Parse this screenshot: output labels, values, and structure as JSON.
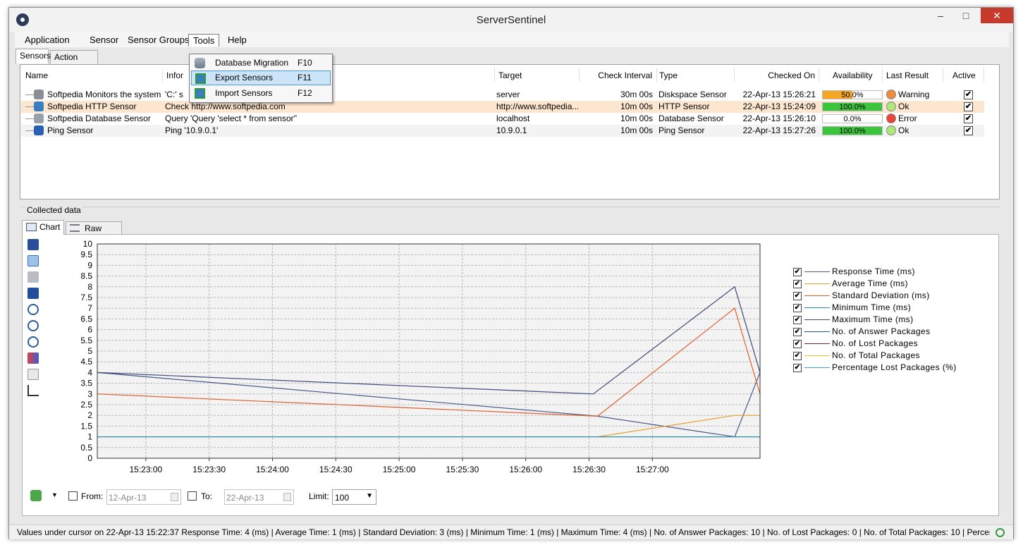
{
  "window": {
    "title": "ServerSentinel",
    "min": "–",
    "max": "□",
    "close": "✕"
  },
  "menu": [
    "Application",
    "Sensor",
    "Sensor Groups",
    "Tools",
    "Help"
  ],
  "tabs_top": [
    "Sensors",
    "Action Log"
  ],
  "columns": [
    "Name",
    "Infor",
    "Target",
    "Check Interval",
    "Type",
    "Checked On",
    "Availability",
    "Last Result",
    "Active"
  ],
  "rows": [
    {
      "name": "Softpedia Monitors the system p...",
      "info": "'C:' s",
      "target": "server",
      "interval": "30m 00s",
      "type": "Diskspace Sensor",
      "checked": "22-Apr-13 15:26:21",
      "availability": "50.0%",
      "avail_value": 0.5,
      "avail_color": "#f5a623",
      "result": "Warning",
      "lamp": "#f08a3c",
      "active": "✔"
    },
    {
      "name": "Softpedia HTTP Sensor",
      "info": "Check http://www.softpedia.com",
      "target": "http://www.softpedia....",
      "interval": "10m 00s",
      "type": "HTTP Sensor",
      "checked": "22-Apr-13 15:24:09",
      "availability": "100.0%",
      "avail_value": 1.0,
      "avail_color": "#3cc43c",
      "result": "Ok",
      "lamp": "#aee67a",
      "active": "✔"
    },
    {
      "name": "Softpedia Database Sensor",
      "info": "Query 'Query 'select * from sensor''",
      "target": "localhost",
      "interval": "10m 00s",
      "type": "Database Sensor",
      "checked": "22-Apr-13 15:26:10",
      "availability": "0.0%",
      "avail_value": 0.0,
      "avail_color": "#3cc43c",
      "result": "Error",
      "lamp": "#e8453c",
      "active": "✔"
    },
    {
      "name": "Ping Sensor",
      "info": "Ping '10.9.0.1'",
      "target": "10.9.0.1",
      "interval": "10m 00s",
      "type": "Ping Sensor",
      "checked": "22-Apr-13 15:27:26",
      "availability": "100.0%",
      "avail_value": 1.0,
      "avail_color": "#3cc43c",
      "result": "Ok",
      "lamp": "#aee67a",
      "active": "✔"
    }
  ],
  "tools_menu": [
    {
      "label": "Database Migration",
      "key": "F10"
    },
    {
      "label": "Export Sensors",
      "key": "F11"
    },
    {
      "label": "Import Sensors",
      "key": "F12"
    }
  ],
  "collected_label": "Collected data",
  "tabs_bottom": [
    "Chart",
    "Raw Data"
  ],
  "chart_data": {
    "type": "line",
    "x_ticks": [
      "15:23:00",
      "15:23:30",
      "15:24:00",
      "15:24:30",
      "15:25:00",
      "15:25:30",
      "15:26:00",
      "15:26:30",
      "15:27:00"
    ],
    "y_ticks": [
      "0",
      "0.5",
      "1",
      "1.5",
      "2",
      "2.5",
      "3",
      "3.5",
      "4",
      "4.5",
      "5",
      "5.5",
      "6",
      "6.5",
      "7",
      "7.5",
      "8",
      "8.5",
      "9",
      "9.5",
      "10"
    ],
    "ylim": [
      0,
      10
    ],
    "x_start": "15:22:37",
    "x_end": "15:27:51",
    "grid": true,
    "series": [
      {
        "name": "Response Time (ms)",
        "color": "#4a5a8a",
        "points": [
          [
            "15:22:37",
            4
          ],
          [
            "15:26:34",
            1.96
          ],
          [
            "15:27:39",
            1
          ],
          [
            "15:27:51",
            4
          ]
        ]
      },
      {
        "name": "Average Time (ms)",
        "color": "#e8a030",
        "points": [
          [
            "15:26:34",
            1
          ],
          [
            "15:27:39",
            2
          ],
          [
            "15:27:51",
            2
          ]
        ]
      },
      {
        "name": "Standard Deviation (ms)",
        "color": "#e06030",
        "points": [
          [
            "15:22:37",
            3
          ],
          [
            "15:26:34",
            1.96
          ],
          [
            "15:27:39",
            7
          ],
          [
            "15:27:51",
            3
          ]
        ]
      },
      {
        "name": "Minimum Time (ms)",
        "color": "#2e8fb0",
        "points": [
          [
            "15:22:37",
            1
          ],
          [
            "15:27:51",
            1
          ]
        ]
      },
      {
        "name": "Maximum Time (ms)",
        "color": "#3e4a78",
        "points": [
          [
            "15:22:37",
            4
          ],
          [
            "15:26:32",
            3
          ],
          [
            "15:27:39",
            8
          ],
          [
            "15:27:51",
            4
          ]
        ]
      },
      {
        "name": "No. of Answer Packages",
        "color": "#1e5a8c",
        "points": []
      },
      {
        "name": "No. of Lost Packages",
        "color": "#7a2030",
        "points": []
      },
      {
        "name": "No. of Total Packages",
        "color": "#e8c030",
        "points": []
      },
      {
        "name": "Percentage Lost Packages (%)",
        "color": "#40a0c0",
        "points": []
      }
    ]
  },
  "filter": {
    "from_label": "From:",
    "from_value": "12-Apr-13",
    "to_label": "To:",
    "to_value": "22-Apr-13",
    "limit_label": "Limit:",
    "limit_value": "100"
  },
  "status": "Values under cursor on 22-Apr-13 15:22:37 Response Time: 4 (ms) | Average Time: 1 (ms) | Standard Deviation: 3 (ms) | Minimum Time: 1 (ms) | Maximum Time: 4 (ms) | No. of Answer Packages: 10 | No. of Lost Packages: 0 | No. of Total Packages: 10 | Percentage"
}
